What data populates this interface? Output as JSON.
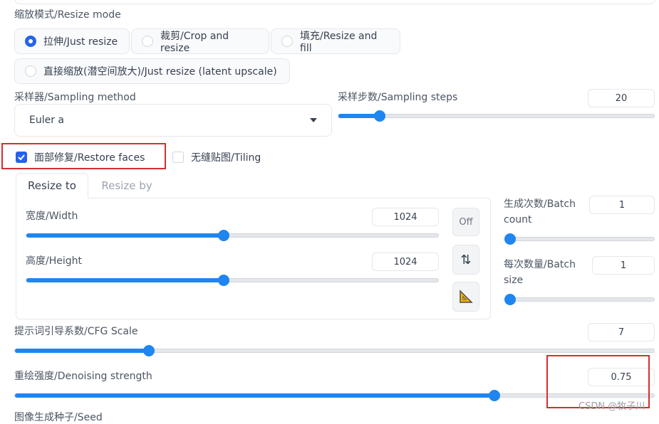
{
  "resize_mode": {
    "label": "缩放模式/Resize mode",
    "options": [
      {
        "label": "拉伸/Just resize",
        "selected": true
      },
      {
        "label": "裁剪/Crop and resize",
        "selected": false
      },
      {
        "label": "填充/Resize and fill",
        "selected": false
      },
      {
        "label": "直接缩放(潜空间放大)/Just resize (latent upscale)",
        "selected": false
      }
    ]
  },
  "sampling_method": {
    "label": "采样器/Sampling method",
    "value": "Euler a"
  },
  "sampling_steps": {
    "label": "采样步数/Sampling steps",
    "value": "20",
    "fraction": 0.13
  },
  "restore_faces": {
    "label": "面部修复/Restore faces",
    "checked": true
  },
  "tiling": {
    "label": "无缝贴图/Tiling",
    "checked": false
  },
  "tabs": [
    {
      "label": "Resize to",
      "active": true
    },
    {
      "label": "Resize by",
      "active": false
    }
  ],
  "width": {
    "label": "宽度/Width",
    "value": "1024",
    "fraction": 0.48
  },
  "height": {
    "label": "高度/Height",
    "value": "1024",
    "fraction": 0.48
  },
  "buttons": {
    "off": "Off",
    "swap": "⇅",
    "ruler": "📐"
  },
  "batch_count": {
    "label": "生成次数/Batch count",
    "value": "1",
    "fraction": 0.0
  },
  "batch_size": {
    "label": "每次数量/Batch size",
    "value": "1",
    "fraction": 0.0
  },
  "cfg_scale": {
    "label": "提示词引导系数/CFG Scale",
    "value": "7",
    "fraction": 0.21
  },
  "denoising": {
    "label": "重绘强度/Denoising strength",
    "value": "0.75",
    "fraction": 0.75
  },
  "seed": {
    "label": "图像生成种子/Seed"
  },
  "watermark": "CSDN @牧子川",
  "colors": {
    "accent": "#2563eb",
    "slider": "#1d86f0",
    "highlight_box": "#d32f2f"
  }
}
